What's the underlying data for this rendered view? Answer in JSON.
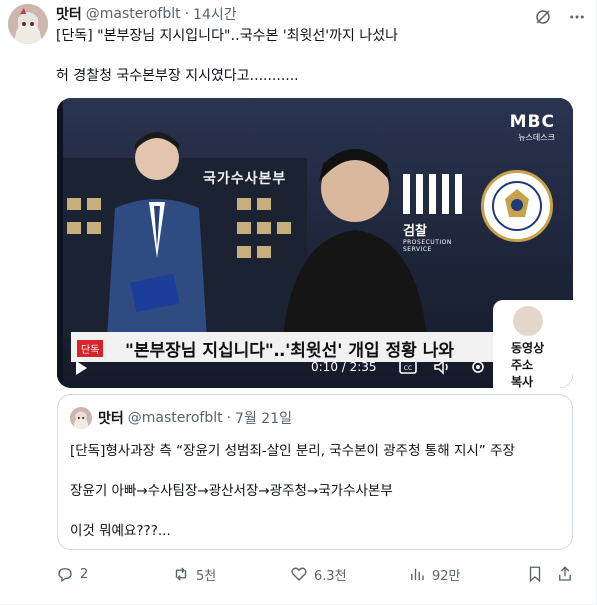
{
  "post": {
    "author_name": "맛터",
    "author_handle": "@masterofblt",
    "separator": "·",
    "time": "14시간",
    "line1": "[단독] \"본부장님 지시입니다\"‥국수본 '최윗선'까지 나섰나",
    "line2": "허 경찰청 국수본부장 지시였다고...........",
    "icons": [
      "grok-icon",
      "more-icon"
    ]
  },
  "video": {
    "building_sign": "국가수사본부",
    "broadcaster_logo": "MBC",
    "broadcaster_sub": "뉴스데스크",
    "prosecution_label": "검찰",
    "prosecution_sub": "PROSECUTION SERVICE",
    "ticker_tag": "단독",
    "ticker_text": "\"본부장님 지십니다\"‥'최윗선' 개입 정황 나와",
    "timestamp": "0:10 / 2:35",
    "pip_lines": [
      "동영상",
      "주소",
      "복사"
    ]
  },
  "quote": {
    "author_name": "맛터",
    "author_handle": "@masterofblt",
    "separator": "·",
    "date": "7월 21일",
    "line1": "[단독]형사과장 측 “장윤기 성범죄-살인 분리, 국수본이 광주청 통해 지시” 주장",
    "line2": "장윤기 아빠→수사팀장→광산서장→광주청→국가수사본부",
    "line3": "이것 뭐예요???..."
  },
  "actions": {
    "replies": "2",
    "reposts": "5천",
    "likes": "6.3천",
    "views": "92만"
  },
  "colors": {
    "text": "#0f1419",
    "muted": "#536471",
    "border": "#cfd9de",
    "ticker_red": "#d8232a"
  }
}
